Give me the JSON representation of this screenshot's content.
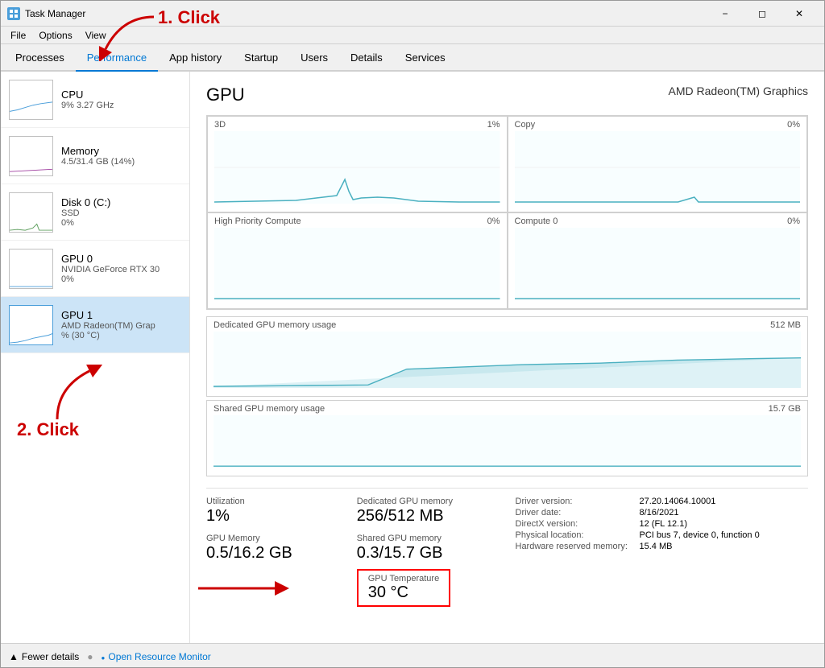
{
  "window": {
    "title": "Task Manager",
    "icon": "TM"
  },
  "menu": {
    "items": [
      "File",
      "Options",
      "View"
    ]
  },
  "tabs": {
    "items": [
      "Processes",
      "Performance",
      "App history",
      "Startup",
      "Users",
      "Details",
      "Services"
    ],
    "active": "Performance"
  },
  "sidebar": {
    "items": [
      {
        "id": "cpu",
        "title": "CPU",
        "sub": "9%  3.27 GHz",
        "pct": ""
      },
      {
        "id": "memory",
        "title": "Memory",
        "sub": "4.5/31.4 GB (14%)",
        "pct": ""
      },
      {
        "id": "disk",
        "title": "Disk 0 (C:)",
        "sub": "SSD",
        "pct": "0%"
      },
      {
        "id": "gpu0",
        "title": "GPU 0",
        "sub": "NVIDIA GeForce RTX 30",
        "pct": "0%"
      },
      {
        "id": "gpu1",
        "title": "GPU 1",
        "sub": "AMD Radeon(TM) Grap",
        "pct": "% (30 °C)",
        "selected": true
      }
    ]
  },
  "content": {
    "gpu_title": "GPU",
    "gpu_model": "AMD Radeon(TM) Graphics",
    "charts": {
      "top_left_label": "3D",
      "top_left_pct": "1%",
      "top_right_label": "Copy",
      "top_right_pct": "0%",
      "bottom_left_label": "High Priority Compute",
      "bottom_left_pct": "0%",
      "bottom_right_label": "Compute 0",
      "bottom_right_pct": "0%",
      "dedicated_label": "Dedicated GPU memory usage",
      "dedicated_max": "512 MB",
      "shared_label": "Shared GPU memory usage",
      "shared_max": "15.7 GB"
    },
    "stats": {
      "utilization_label": "Utilization",
      "utilization_value": "1%",
      "dedicated_mem_label": "Dedicated GPU memory",
      "dedicated_mem_value": "256/512 MB",
      "gpu_mem_label": "GPU Memory",
      "gpu_mem_value": "0.5/16.2 GB",
      "shared_mem_label": "Shared GPU memory",
      "shared_mem_value": "0.3/15.7 GB"
    },
    "driver": {
      "version_label": "Driver version:",
      "version_value": "27.20.14064.10001",
      "date_label": "Driver date:",
      "date_value": "8/16/2021",
      "directx_label": "DirectX version:",
      "directx_value": "12 (FL 12.1)",
      "location_label": "Physical location:",
      "location_value": "PCI bus 7, device 0, function 0",
      "hw_reserved_label": "Hardware reserved memory:",
      "hw_reserved_value": "15.4 MB"
    },
    "temperature": {
      "label": "GPU Temperature",
      "value": "30 °C"
    }
  },
  "bottom_bar": {
    "fewer_details": "Fewer details",
    "open_monitor": "Open Resource Monitor"
  },
  "annotations": {
    "click1": "1. Click",
    "click2": "2. Click"
  }
}
